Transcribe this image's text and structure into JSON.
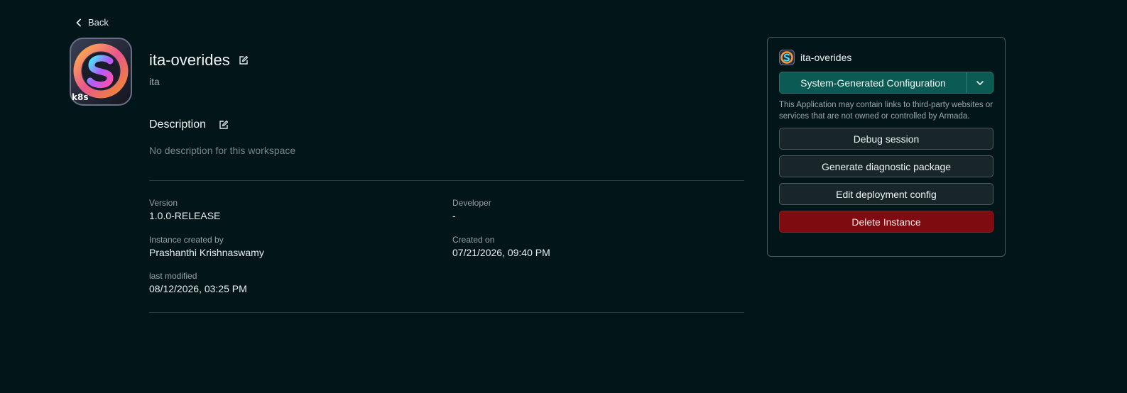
{
  "nav": {
    "back_label": "Back"
  },
  "app": {
    "title": "ita-overides",
    "subtitle": "ita",
    "logo_badge": "k8s"
  },
  "description": {
    "heading": "Description",
    "text": "No description for this workspace"
  },
  "meta": {
    "version": {
      "label": "Version",
      "value": "1.0.0-RELEASE"
    },
    "developer": {
      "label": "Developer",
      "value": "-"
    },
    "created_by": {
      "label": "Instance created by",
      "value": "Prashanthi Krishnaswamy"
    },
    "created_on": {
      "label": "Created on",
      "value": "07/21/2026, 09:40 PM"
    },
    "last_modified": {
      "label": "last modified",
      "value": "08/12/2026, 03:25 PM"
    }
  },
  "panel": {
    "title": "ita-overides",
    "config_select": "System-Generated Configuration",
    "disclaimer": "This Application may contain links to third-party websites or services that are not owned or controlled by Armada.",
    "buttons": {
      "debug": "Debug session",
      "diagnostic": "Generate diagnostic package",
      "edit_config": "Edit deployment config",
      "delete": "Delete Instance"
    }
  },
  "colors": {
    "background": "#02161a",
    "primary": "#0b5b54",
    "danger": "#7d0b10"
  },
  "icons": [
    "chevron-left-icon",
    "edit-icon",
    "chevron-down-icon",
    "app-logo"
  ]
}
